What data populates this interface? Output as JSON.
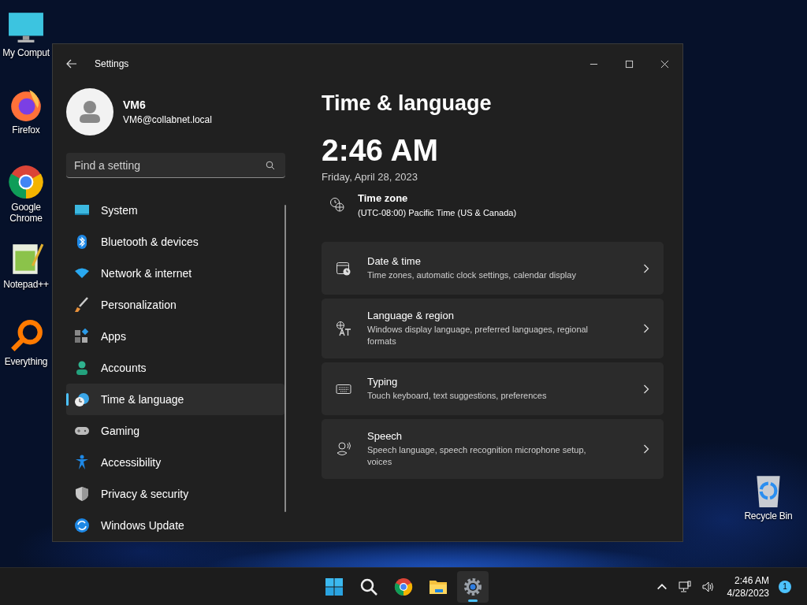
{
  "desktop_icons": [
    {
      "label": "My Comput"
    },
    {
      "label": "Firefox"
    },
    {
      "label": "Google Chrome"
    },
    {
      "label": "Notepad++"
    },
    {
      "label": "Everything"
    }
  ],
  "recycle_bin": {
    "label": "Recycle Bin"
  },
  "window": {
    "title": "Settings"
  },
  "profile": {
    "name": "VM6",
    "email": "VM6@collabnet.local"
  },
  "search": {
    "placeholder": "Find a setting"
  },
  "sidebar": {
    "items": [
      {
        "label": "System",
        "selected": false
      },
      {
        "label": "Bluetooth & devices",
        "selected": false
      },
      {
        "label": "Network & internet",
        "selected": false
      },
      {
        "label": "Personalization",
        "selected": false
      },
      {
        "label": "Apps",
        "selected": false
      },
      {
        "label": "Accounts",
        "selected": false
      },
      {
        "label": "Time & language",
        "selected": true
      },
      {
        "label": "Gaming",
        "selected": false
      },
      {
        "label": "Accessibility",
        "selected": false
      },
      {
        "label": "Privacy & security",
        "selected": false
      },
      {
        "label": "Windows Update",
        "selected": false
      }
    ]
  },
  "page": {
    "title": "Time & language",
    "time": "2:46 AM",
    "date": "Friday, April 28, 2023",
    "time_zone": {
      "label": "Time zone",
      "value": "(UTC-08:00) Pacific Time (US & Canada)"
    }
  },
  "cards": [
    {
      "title": "Date & time",
      "description": "Time zones, automatic clock settings, calendar display"
    },
    {
      "title": "Language & region",
      "description": "Windows display language, preferred languages, regional formats"
    },
    {
      "title": "Typing",
      "description": "Touch keyboard, text suggestions, preferences"
    },
    {
      "title": "Speech",
      "description": "Speech language, speech recognition microphone setup, voices"
    }
  ],
  "taskbar": {
    "apps": [
      {
        "selected": false
      },
      {
        "selected": false
      },
      {
        "selected": false
      },
      {
        "selected": false
      },
      {
        "selected": true
      }
    ],
    "clock": {
      "time": "2:46 AM",
      "date": "4/28/2023"
    },
    "notification_count": "1"
  }
}
